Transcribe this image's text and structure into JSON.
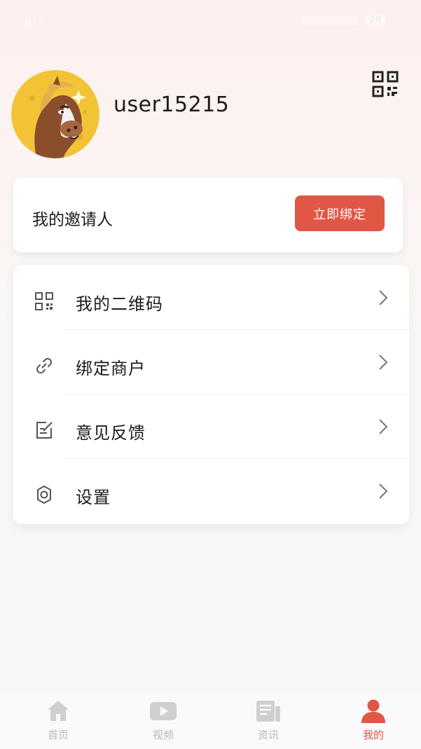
{
  "status_bar": {
    "time": "8:2",
    "battery": "78"
  },
  "profile": {
    "username": "user15215"
  },
  "inviter": {
    "label": "我的邀请人",
    "bind_button": "立即绑定"
  },
  "menu": {
    "items": [
      {
        "label": "我的二维码",
        "icon": "qr-code-icon"
      },
      {
        "label": "绑定商户",
        "icon": "link-icon"
      },
      {
        "label": "意见反馈",
        "icon": "edit-note-icon"
      },
      {
        "label": "设置",
        "icon": "gear-icon"
      }
    ]
  },
  "bottom_nav": {
    "items": [
      {
        "label": "首页",
        "icon": "home-icon",
        "active": false
      },
      {
        "label": "视频",
        "icon": "video-play-icon",
        "active": false
      },
      {
        "label": "资讯",
        "icon": "news-icon",
        "active": false
      },
      {
        "label": "我的",
        "icon": "person-icon",
        "active": true
      }
    ]
  },
  "colors": {
    "accent": "#e15645",
    "inactive": "#b8b8b8",
    "card_bg": "#ffffff"
  }
}
